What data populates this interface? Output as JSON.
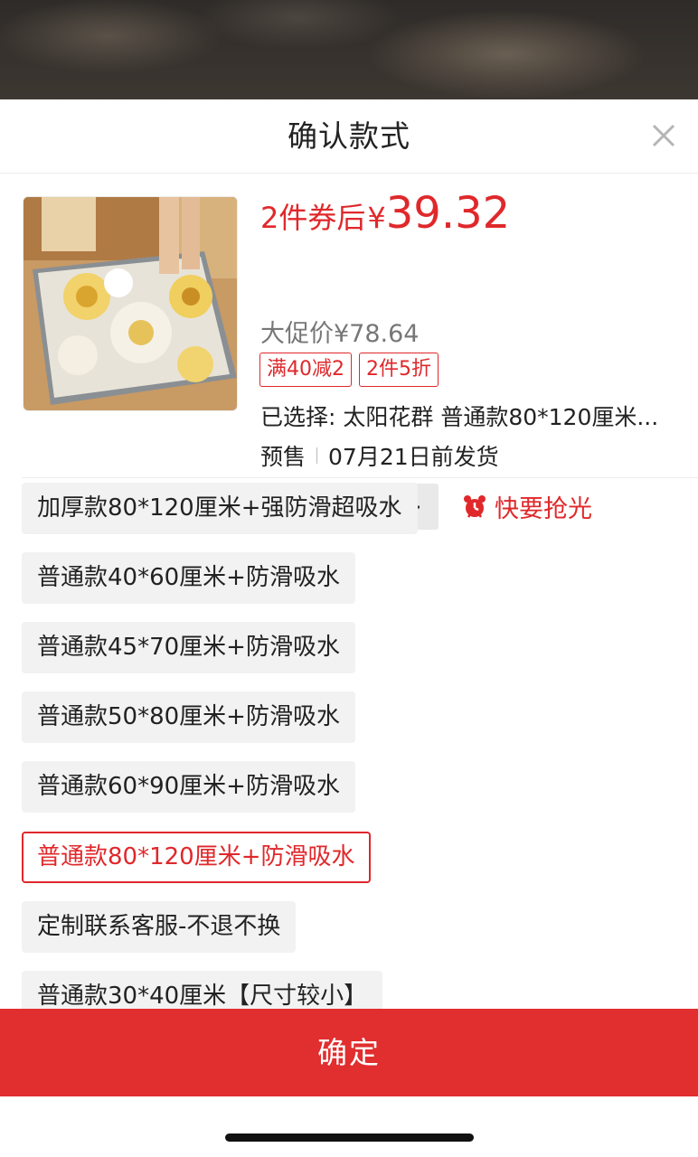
{
  "sheet": {
    "title": "确认款式"
  },
  "product": {
    "price_prefix": "2件券后",
    "currency": "¥",
    "price_value": "39.32",
    "promo_price": "大促价¥78.64",
    "tags": [
      "满40减2",
      "2件5折"
    ],
    "selected_text": "已选择: 太阳花群 普通款80*120厘米...",
    "presale_label": "预售",
    "ship_date": "07月21日前发货",
    "quantity": "2",
    "hurry_text": "快要抢光"
  },
  "options": [
    {
      "label": "加厚款80*120厘米+强防滑超吸水",
      "selected": false
    },
    {
      "label": "普通款40*60厘米+防滑吸水",
      "selected": false
    },
    {
      "label": "普通款45*70厘米+防滑吸水",
      "selected": false
    },
    {
      "label": "普通款50*80厘米+防滑吸水",
      "selected": false
    },
    {
      "label": "普通款60*90厘米+防滑吸水",
      "selected": false
    },
    {
      "label": "普通款80*120厘米+防滑吸水",
      "selected": true
    },
    {
      "label": "定制联系客服-不退不换",
      "selected": false
    },
    {
      "label": "普通款30*40厘米【尺寸较小】",
      "selected": false
    }
  ],
  "footer": {
    "confirm_label": "确定"
  },
  "colors": {
    "accent": "#e0282b",
    "confirm_bg": "#e12e2e",
    "option_bg": "#f2f2f2"
  },
  "icons": {
    "close": "close-icon",
    "minus": "minus-icon",
    "plus": "plus-icon",
    "alarm": "alarm-clock-icon"
  }
}
